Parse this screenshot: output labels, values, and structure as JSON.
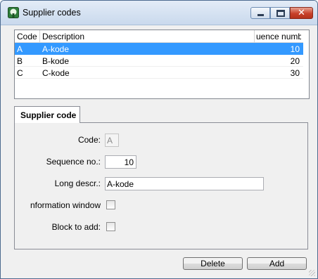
{
  "window": {
    "title": "Supplier codes"
  },
  "list": {
    "columns": [
      "Code",
      "Description",
      "uence number"
    ],
    "rows": [
      {
        "code": "A",
        "description": "A-kode",
        "sequence": "10",
        "selected": true
      },
      {
        "code": "B",
        "description": "B-kode",
        "sequence": "20",
        "selected": false
      },
      {
        "code": "C",
        "description": "C-kode",
        "sequence": "30",
        "selected": false
      }
    ]
  },
  "tab": {
    "label": "Supplier code"
  },
  "form": {
    "code_label": "Code:",
    "code_value": "A",
    "sequence_label": "Sequence no.:",
    "sequence_value": "10",
    "long_descr_label": "Long descr.:",
    "long_descr_value": "A-kode",
    "info_window_label": "nformation window",
    "info_window_checked": false,
    "block_label": "Block to add:",
    "block_checked": false
  },
  "buttons": {
    "delete": "Delete",
    "add": "Add"
  },
  "colors": {
    "selection": "#3399ff",
    "close_button": "#c8412a"
  }
}
